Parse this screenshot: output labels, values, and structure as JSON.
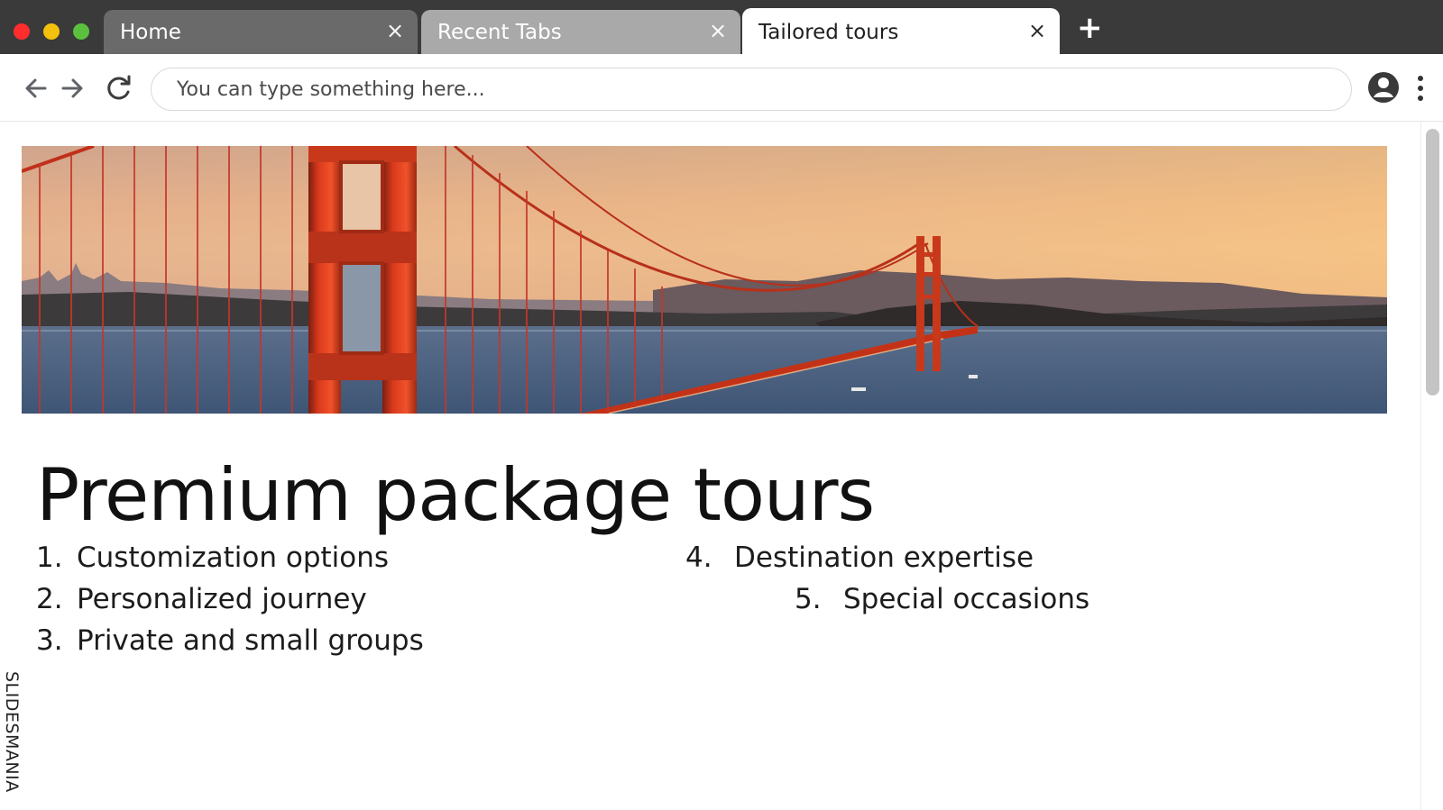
{
  "window": {
    "controls": [
      "close",
      "minimize",
      "maximize"
    ],
    "colors": {
      "close": "#ff2d2d",
      "minimize": "#f4c20d",
      "maximize": "#5cc03f"
    }
  },
  "tabs": [
    {
      "label": "Home",
      "close_icon": "×",
      "active": false
    },
    {
      "label": "Recent Tabs",
      "close_icon": "×",
      "active": false
    },
    {
      "label": "Tailored tours",
      "close_icon": "×",
      "active": true
    }
  ],
  "new_tab_icon": "+",
  "toolbar": {
    "back_icon": "arrow-left-icon",
    "forward_icon": "arrow-right-icon",
    "reload_icon": "reload-icon",
    "address_placeholder": "You can type something here...",
    "address_value": "",
    "profile_icon": "user-circle-icon",
    "menu_icon": "kebab-menu-icon"
  },
  "page": {
    "banner_image": "golden-gate-bridge-panorama",
    "title": "Premium package tours",
    "list": [
      {
        "number": "1.",
        "text": "Customization options"
      },
      {
        "number": "2.",
        "text": "Personalized journey"
      },
      {
        "number": "3.",
        "text": "Private and small groups"
      },
      {
        "number": "4.",
        "text": "Destination expertise"
      },
      {
        "number": "5.",
        "text": "Special occasions"
      }
    ],
    "watermark": "SLIDESMANIA"
  }
}
